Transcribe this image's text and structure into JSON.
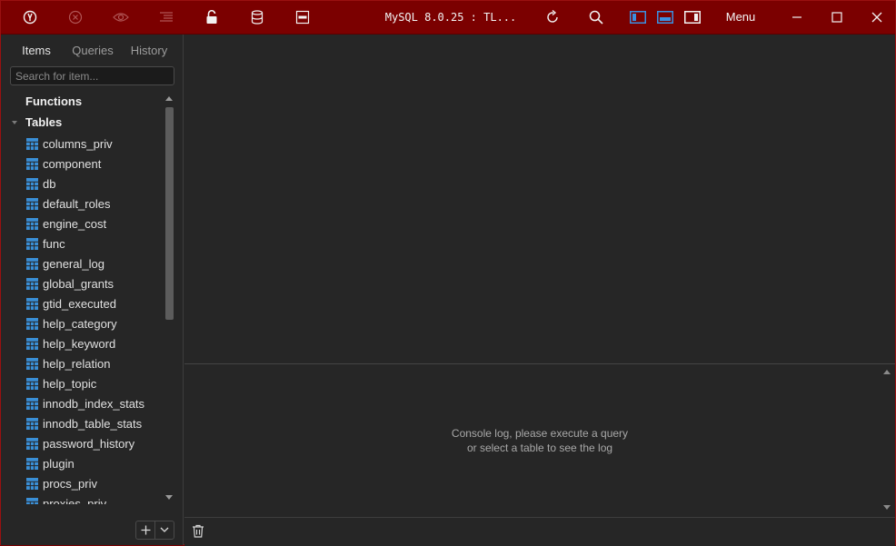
{
  "window": {
    "title": "MySQL 8.0.25 : TL...",
    "menu_label": "Menu"
  },
  "toolbar": {
    "icons": [
      "connect-icon",
      "disconnect-icon",
      "eye-icon",
      "format-icon",
      "lock-icon",
      "database-icon",
      "sql-file-icon",
      "refresh-icon",
      "search-icon",
      "layout-left-icon",
      "layout-bottom-icon",
      "layout-right-icon",
      "minimize-icon",
      "maximize-icon",
      "close-icon"
    ]
  },
  "sidebar": {
    "tabs": [
      {
        "label": "Items"
      },
      {
        "label": "Queries"
      },
      {
        "label": "History"
      }
    ],
    "search": {
      "placeholder": "Search for item...",
      "value": ""
    },
    "groups": {
      "functions": "Functions",
      "tables": "Tables"
    },
    "tables": [
      "columns_priv",
      "component",
      "db",
      "default_roles",
      "engine_cost",
      "func",
      "general_log",
      "global_grants",
      "gtid_executed",
      "help_category",
      "help_keyword",
      "help_relation",
      "help_topic",
      "innodb_index_stats",
      "innodb_table_stats",
      "password_history",
      "plugin",
      "procs_priv",
      "proxies_priv"
    ]
  },
  "console": {
    "line1": "Console log, please execute a query",
    "line2": "or select a table to see the log"
  },
  "colors": {
    "titlebar": "#7b0000",
    "background": "#262626",
    "table_icon": "#3a8fd6",
    "layout_active": "#3b8fe0"
  }
}
